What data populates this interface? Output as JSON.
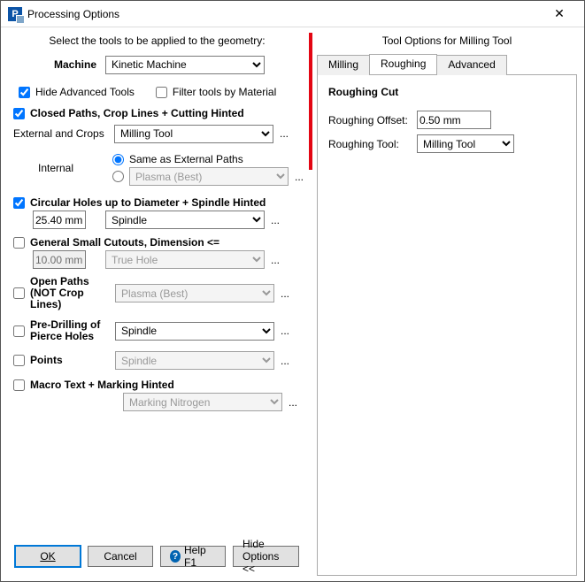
{
  "title": "Processing Options",
  "left": {
    "caption": "Select the tools to be applied to the geometry:",
    "machine_label": "Machine",
    "machine_value": "Kinetic Machine",
    "hide_adv": "Hide Advanced Tools",
    "filter_by_mat": "Filter tools by Material",
    "closed_paths_label": "Closed Paths,  Crop Lines  +  Cutting Hinted",
    "ext_crops_label": "External and Crops",
    "ext_crops_value": "Milling Tool",
    "internal_label": "Internal",
    "internal_same": "Same as External Paths",
    "internal_value": "Plasma (Best)",
    "circ_label": "Circular Holes up to Diameter   +  Spindle Hinted",
    "circ_dia": "25.40 mm",
    "circ_tool": "Spindle",
    "small_label": "General Small Cutouts, Dimension <=",
    "small_dim": "10.00 mm",
    "small_tool": "True Hole",
    "open_label": "Open Paths (NOT Crop Lines)",
    "open_tool": "Plasma (Best)",
    "pre_label": "Pre-Drilling of Pierce Holes",
    "pre_tool": "Spindle",
    "pts_label": "Points",
    "pts_tool": "Spindle",
    "macro_label": "Macro Text   +  Marking Hinted",
    "macro_tool": "Marking Nitrogen",
    "btn_ok": "OK",
    "btn_cancel": "Cancel",
    "btn_help": "Help F1",
    "btn_hide": "Hide Options <<",
    "more": "..."
  },
  "right": {
    "caption": "Tool Options for Milling Tool",
    "tab_milling": "Milling",
    "tab_rough": "Roughing",
    "tab_adv": "Advanced",
    "heading": "Roughing Cut",
    "offset_label": "Roughing Offset:",
    "offset_value": "0.50 mm",
    "tool_label": "Roughing Tool:",
    "tool_value": "Milling Tool"
  }
}
